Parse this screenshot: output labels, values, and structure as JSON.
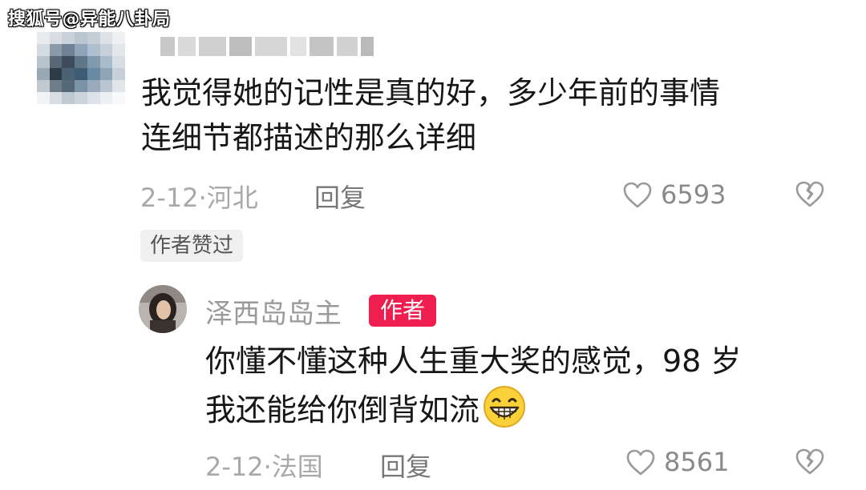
{
  "watermark": "搜狐号@异能八卦局",
  "comment": {
    "line1": "我觉得她的记性是真的好，多少年前的事情",
    "line2": "连细节都描述的那么详细",
    "date_location": "2-12·河北",
    "reply_label": "回复",
    "likes": "6593",
    "author_liked_badge": "作者赞过"
  },
  "reply": {
    "username": "泽西岛岛主",
    "author_badge": "作者",
    "line1": "你懂不懂这种人生重大奖的感觉，98 岁",
    "line2": "我还能给你倒背如流",
    "emoji": "grinning-face",
    "date_location": "2-12·法国",
    "reply_label": "回复",
    "likes": "8561"
  },
  "icons": {
    "like": "heart-outline-icon",
    "dislike": "broken-heart-outline-icon"
  },
  "colors": {
    "author_badge": "#ee1f4f",
    "meta_text": "#a8a8a8",
    "badge_bg": "#f0f0f0"
  }
}
